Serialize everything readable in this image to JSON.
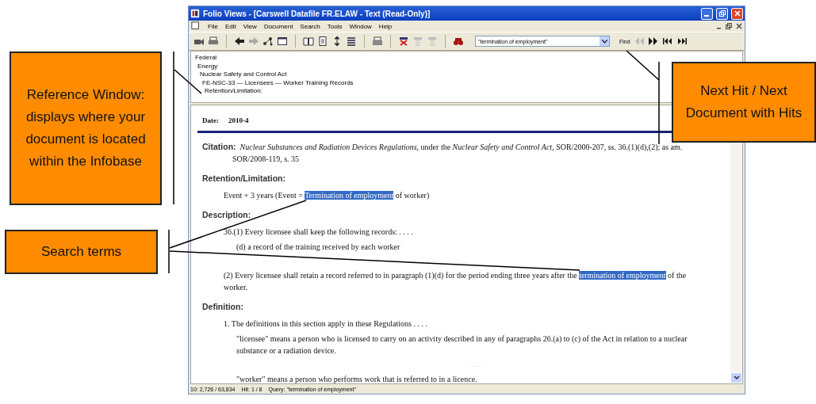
{
  "window": {
    "title": "Folio Views - [Carswell Datafile FR.ELAW - Text  (Read-Only)]"
  },
  "menu": [
    "File",
    "Edit",
    "View",
    "Document",
    "Search",
    "Tools",
    "Window",
    "Help"
  ],
  "toolbar": {
    "query": "\"termination of employment\"",
    "find_label": "Find"
  },
  "reference": [
    {
      "label": "Federal",
      "children": [
        {
          "label": "Energy",
          "children": [
            {
              "label": "Nuclear Safety and Control Act",
              "children": [
                {
                  "label": "FE-NSC-33  — Licensees  — Worker Training Records",
                  "children": [
                    {
                      "label": "Retention/Limitation:"
                    }
                  ]
                }
              ]
            }
          ]
        }
      ]
    }
  ],
  "document": {
    "date_label": "Date:",
    "date": "2010-4",
    "blocks": [
      {
        "kind": "citation",
        "label": "Citation:",
        "text": "*Nuclear Substances and Radiation Devices Regulations*, under the *Nuclear Safety and Control Act*, SOR/2000-207, ss. 36.(1)(d),(2); as am. SOR/2008-119, s. 35"
      },
      {
        "kind": "heading",
        "text": "Retention/Limitation:"
      },
      {
        "kind": "para",
        "segments": [
          {
            "text": "Event + 3 years (Event = ",
            "hit": false
          },
          {
            "text": "Termination of employment",
            "hit": true
          },
          {
            "text": " of worker)",
            "hit": false
          }
        ]
      },
      {
        "kind": "heading",
        "text": "Description:"
      },
      {
        "kind": "para",
        "segments": [
          {
            "text": "36.(1) Every licensee shall keep the following records: . . . .",
            "hit": false
          }
        ],
        "children": [
          {
            "kind": "para",
            "segments": [
              {
                "text": "(d) a record of the training received by each worker",
                "hit": false
              }
            ]
          }
        ]
      },
      {
        "kind": "dots",
        "text": ". . . . ."
      },
      {
        "kind": "para",
        "segments": [
          {
            "text": "(2) Every licensee shall retain a record referred to in paragraph (1)(d) for the period ending three years after the ",
            "hit": false
          },
          {
            "text": "termination of employment",
            "hit": true
          },
          {
            "text": " of the worker.",
            "hit": false
          }
        ]
      },
      {
        "kind": "heading",
        "text": "Definition:"
      },
      {
        "kind": "para",
        "segments": [
          {
            "text": "1. The definitions in this section apply in these Regulations . . . .",
            "hit": false
          }
        ],
        "children": [
          {
            "kind": "para",
            "segments": [
              {
                "text": "\"licensee\" means a person who is licensed to carry on an activity described in any of paragraphs 26.(a) to (c) of the Act in relation to a nuclear substance or a radiation device.",
                "hit": false
              }
            ]
          },
          {
            "kind": "dots",
            "text": ". . . . ."
          },
          {
            "kind": "para",
            "segments": [
              {
                "text": "\"worker\" means a person who performs work that is referred to in a licence.",
                "hit": false
              }
            ]
          }
        ]
      }
    ]
  },
  "status_bar": [
    "10: 2,726 / 63,834",
    "Hit: 1 / 8",
    "Query: \"termination of employment\""
  ],
  "callouts": [
    {
      "kind": "reference",
      "text": "Reference Window: displays where your document is located within the Infobase"
    },
    {
      "kind": "search",
      "text": "Search terms"
    },
    {
      "kind": "next",
      "text": "Next Hit / Next Document with Hits"
    }
  ]
}
